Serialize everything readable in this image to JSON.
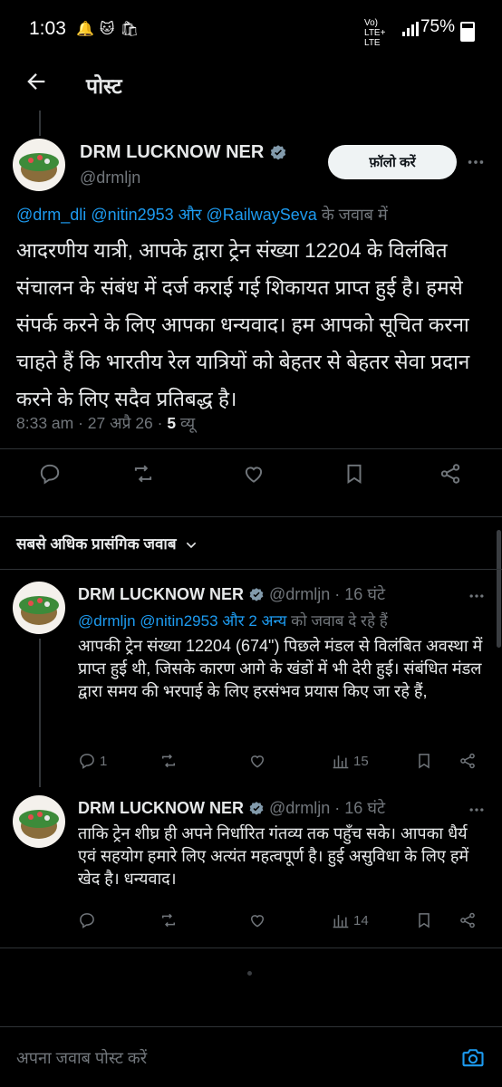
{
  "status": {
    "time": "1:03",
    "network": "Vo) LTE+ LTE",
    "battery": "75%"
  },
  "header": {
    "title": "पोस्ट"
  },
  "post": {
    "author_name": "DRM LUCKNOW NER",
    "handle": "@drmljn",
    "follow_label": "फ़ॉलो करें",
    "reply_to": {
      "prefix_a": "@drm_dli",
      "prefix_b": "@nitin2953",
      "and": "और",
      "prefix_c": "@RailwaySeva",
      "suffix": "के जवाब में"
    },
    "text": "आदरणीय यात्री, आपके द्वारा ट्रेन संख्या 12204 के विलंबित संचालन के संबंध में दर्ज कराई गई शिकायत प्राप्त हुई है। हमसे संपर्क करने के लिए आपका धन्यवाद। हम आपको सूचित करना चाहते हैं कि भारतीय रेल यात्रियों को बेहतर से बेहतर सेवा प्रदान करने के लिए सदैव प्रतिबद्ध है।",
    "time": "8:33 am",
    "date": "27 अप्रै 26",
    "views_count": "5",
    "views_label": "व्यू"
  },
  "sort": {
    "label": "सबसे अधिक प्रासंगिक जवाब"
  },
  "replies": [
    {
      "author_name": "DRM LUCKNOW NER",
      "handle": "@drmljn",
      "age": "16 घंटे",
      "reply_to": {
        "a": "@drmljn",
        "b": "@nitin2953",
        "and": "और",
        "c": "2 अन्य",
        "suffix": "को जवाब दे रहे हैं"
      },
      "text": "आपकी ट्रेन संख्या 12204 (674\") पिछले मंडल से विलंबित अवस्था में प्राप्त हुई थी, जिसके कारण आगे के खंडों में भी देरी हुई। संबंधित मंडल द्वारा समय की भरपाई के लिए हरसंभव प्रयास किए जा रहे हैं,",
      "replies_count": "1",
      "views_count": "15"
    },
    {
      "author_name": "DRM LUCKNOW NER",
      "handle": "@drmljn",
      "age": "16 घंटे",
      "text": "ताकि ट्रेन शीघ्र ही अपने निर्धारित गंतव्य तक पहुँच सके। आपका धैर्य एवं सहयोग हमारे लिए अत्यंत महत्वपूर्ण है। हुई असुविधा के लिए हमें खेद है। धन्यवाद।",
      "replies_count": "",
      "views_count": "14"
    }
  ],
  "composer": {
    "placeholder": "अपना जवाब पोस्ट करें"
  },
  "colors": {
    "accent": "#1d9bf0",
    "background": "#000000",
    "muted": "#71767b",
    "verified": "#829aab"
  }
}
